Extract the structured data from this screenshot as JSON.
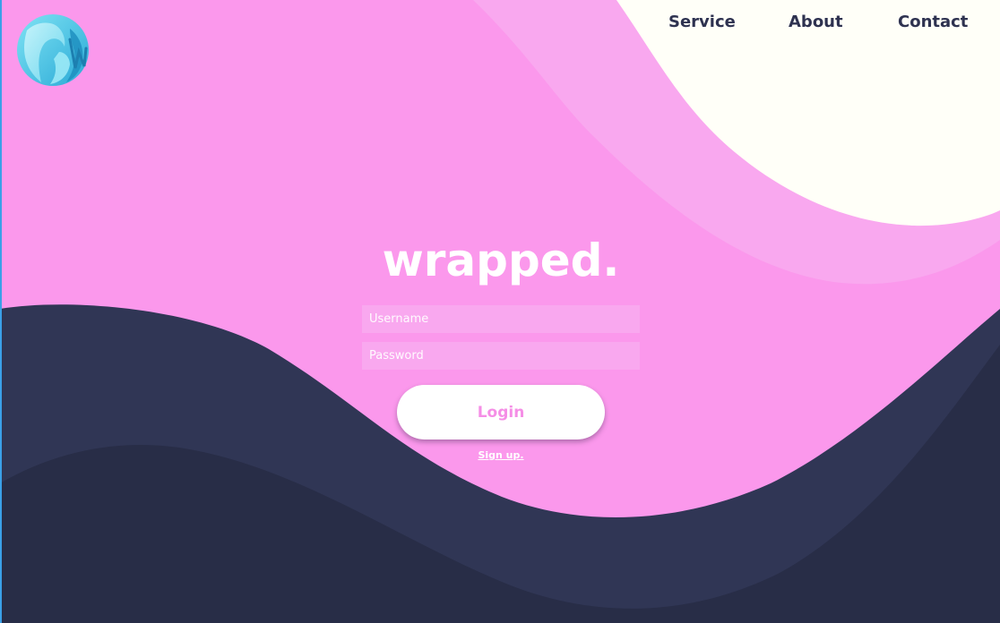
{
  "nav": {
    "items": [
      {
        "label": "Service"
      },
      {
        "label": "About"
      },
      {
        "label": "Contact"
      }
    ]
  },
  "brand": {
    "title": "wrapped."
  },
  "form": {
    "username_placeholder": "Username",
    "password_placeholder": "Password",
    "login_label": "Login",
    "signup_label": "Sign up."
  },
  "colors": {
    "background_pink": "#fb98ec",
    "light_pink": "#f9a8ef",
    "cream": "#fffff8",
    "navy": "#303655",
    "dark_navy": "#282d47",
    "login_text": "#f58ee6",
    "nav_text": "#2e3250",
    "logo_cyan": "#3ec9e6"
  },
  "icons": {
    "logo": "wrapped-logo-icon"
  }
}
